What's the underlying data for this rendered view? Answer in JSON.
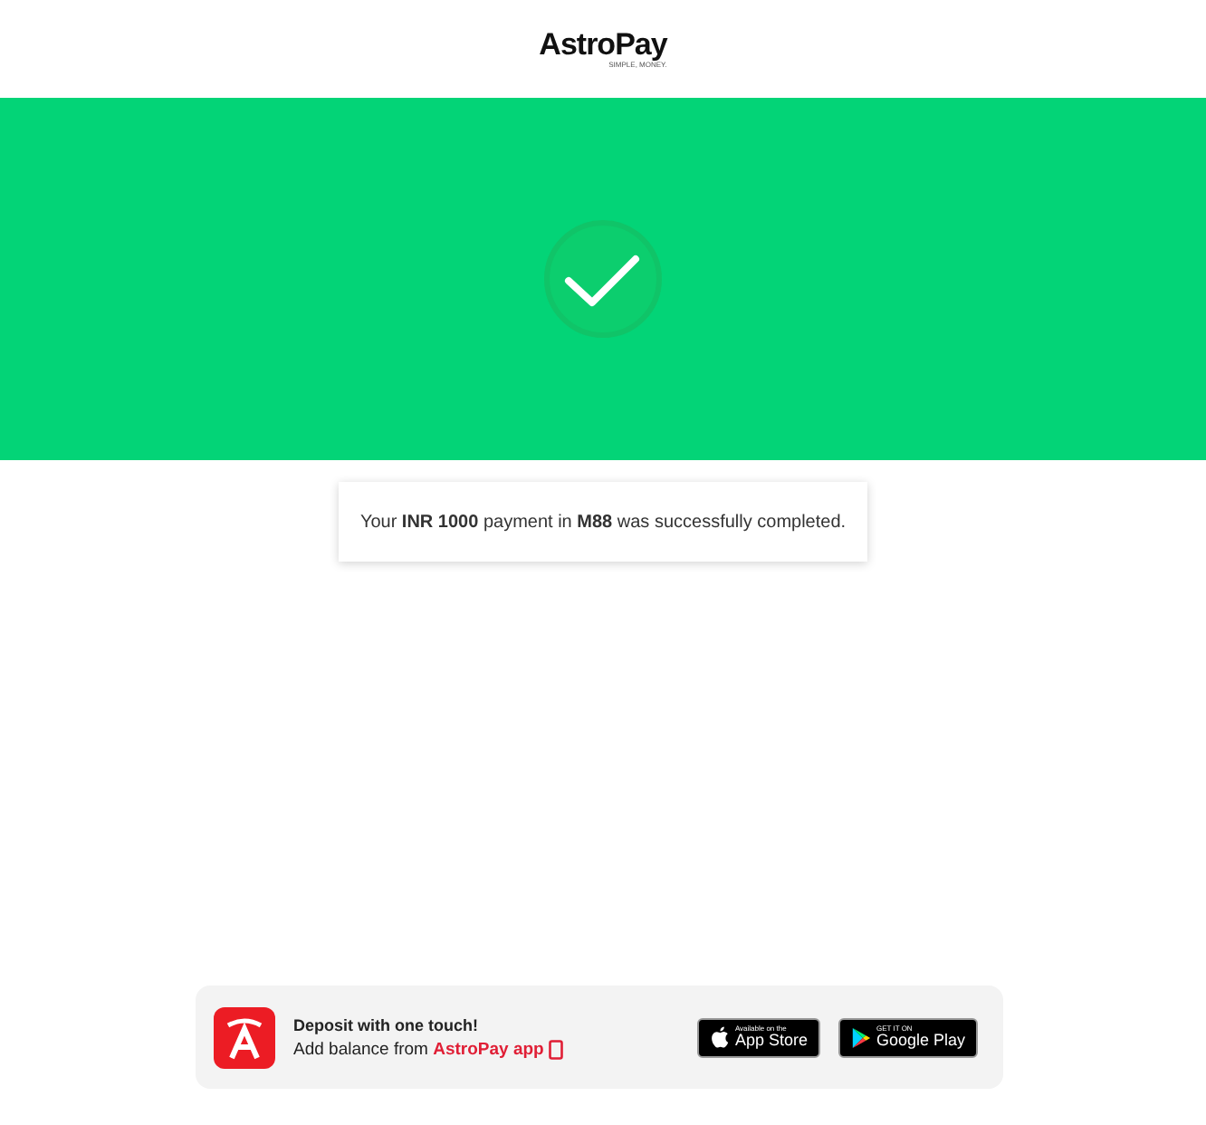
{
  "header": {
    "logo": "AstroPay",
    "tagline": "SIMPLE, MONEY."
  },
  "status": {
    "message": "Your **INR 1000** payment in **M88** was successfully completed."
  },
  "promo": {
    "title": "Deposit with one touch!",
    "subtitle": "Add balance from",
    "link": "AstroPay app",
    "badges": [
      {
        "kind": "apple",
        "small": "Available on the",
        "large": "App Store"
      },
      {
        "kind": "google",
        "small": "GET IT ON",
        "large": "Google Play"
      }
    ]
  }
}
